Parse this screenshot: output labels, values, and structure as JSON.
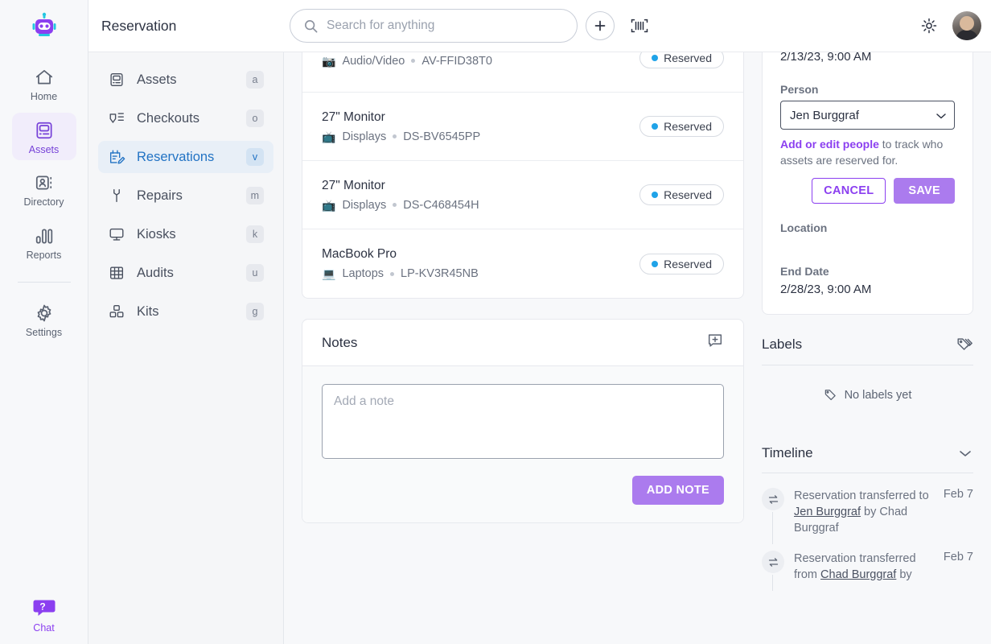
{
  "rail": {
    "logo_icon": "robot-logo-icon",
    "items": [
      {
        "label": "Home",
        "icon": "home-icon",
        "active": false
      },
      {
        "label": "Assets",
        "icon": "computer-icon",
        "active": true
      },
      {
        "label": "Directory",
        "icon": "contact-card-icon",
        "active": false
      },
      {
        "label": "Reports",
        "icon": "bar-chart-icon",
        "active": false
      },
      {
        "label": "Settings",
        "icon": "gear-icon",
        "active": false
      }
    ],
    "chat": {
      "label": "Chat",
      "icon": "chat-help-icon"
    }
  },
  "header": {
    "title": "Reservation",
    "search": {
      "placeholder": "Search for anything",
      "value": "",
      "icon": "search-icon"
    },
    "add_button_icon": "plus-icon",
    "barcode_button_icon": "barcode-scan-icon",
    "theme_toggle_icon": "sun-icon",
    "avatar_icon": "user-avatar"
  },
  "subnav": {
    "items": [
      {
        "label": "Assets",
        "shortcut": "a",
        "icon": "computer-icon",
        "active": false
      },
      {
        "label": "Checkouts",
        "shortcut": "o",
        "icon": "checkout-icon",
        "active": false
      },
      {
        "label": "Reservations",
        "shortcut": "v",
        "icon": "calendar-edit-icon",
        "active": true
      },
      {
        "label": "Repairs",
        "shortcut": "m",
        "icon": "wrench-icon",
        "active": false
      },
      {
        "label": "Kiosks",
        "shortcut": "k",
        "icon": "monitor-icon",
        "active": false
      },
      {
        "label": "Audits",
        "shortcut": "u",
        "icon": "grid-icon",
        "active": false
      },
      {
        "label": "Kits",
        "shortcut": "g",
        "icon": "boxes-icon",
        "active": false
      }
    ]
  },
  "assets": {
    "rows": [
      {
        "name": "",
        "category": "Audio/Video",
        "category_icon": "camera-emoji",
        "tag": "AV-FFID38T0",
        "status": "Reserved",
        "partial": true
      },
      {
        "name": "27\" Monitor",
        "category": "Displays",
        "category_icon": "tv-emoji",
        "tag": "DS-BV6545PP",
        "status": "Reserved",
        "partial": false
      },
      {
        "name": "27\" Monitor",
        "category": "Displays",
        "category_icon": "tv-emoji",
        "tag": "DS-C468454H",
        "status": "Reserved",
        "partial": false
      },
      {
        "name": "MacBook Pro",
        "category": "Laptops",
        "category_icon": "laptop-emoji",
        "tag": "LP-KV3R45NB",
        "status": "Reserved",
        "partial": false
      }
    ],
    "status_dot_color": "#1fa3e8"
  },
  "notes": {
    "title": "Notes",
    "add_icon": "add-comment-icon",
    "input_placeholder": "Add a note",
    "input_value": "",
    "add_note_label": "ADD NOTE"
  },
  "detail": {
    "start_date_value": "2/13/23, 9:00 AM",
    "person_label": "Person",
    "person_value": "Jen Burggraf",
    "person_options": [
      "Jen Burggraf",
      "Chad Burggraf"
    ],
    "helper_link": "Add or edit people",
    "helper_rest": " to track who assets are reserved for.",
    "cancel_label": "CANCEL",
    "save_label": "SAVE",
    "location_label": "Location",
    "location_value": "",
    "end_date_label": "End Date",
    "end_date_value": "2/28/23, 9:00 AM"
  },
  "labels": {
    "title": "Labels",
    "icon": "tags-icon",
    "empty_text": "No labels yet",
    "empty_icon": "tag-icon"
  },
  "timeline": {
    "title": "Timeline",
    "collapse_icon": "chevron-down-icon",
    "events": [
      {
        "icon": "transfer-icon",
        "prefix": "Reservation transferred to ",
        "link": "Jen Burggraf",
        "suffix": " by Chad Burggraf",
        "date": "Feb 7"
      },
      {
        "icon": "transfer-icon",
        "prefix": "Reservation transferred from ",
        "link": "Chad Burggraf",
        "suffix": " by",
        "date": "Feb 7"
      }
    ]
  },
  "colors": {
    "accent_purple": "#8b3ff0",
    "button_purple": "#ab7bee",
    "active_blue": "#2273c4",
    "status_blue": "#1fa3e8"
  }
}
